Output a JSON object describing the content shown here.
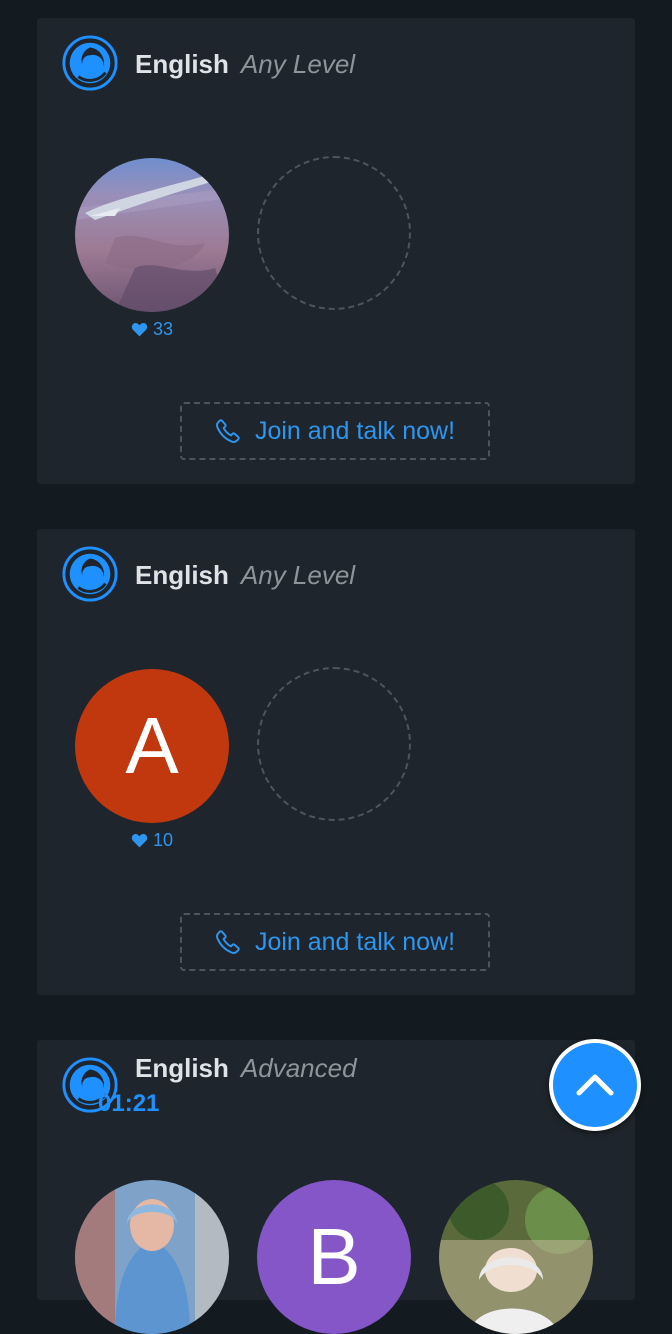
{
  "rooms": [
    {
      "language": "English",
      "level": "Any Level",
      "host": {
        "type": "photo",
        "likes": "33"
      },
      "join_label": "Join and talk now!"
    },
    {
      "language": "English",
      "level": "Any Level",
      "host": {
        "type": "letter",
        "letter": "A",
        "color": "#c1380f",
        "likes": "10"
      },
      "join_label": "Join and talk now!"
    },
    {
      "language": "English",
      "level": "Advanced",
      "timer": "01:21",
      "participants": [
        {
          "type": "photo"
        },
        {
          "type": "letter",
          "letter": "B",
          "color": "#8456c7"
        },
        {
          "type": "photo"
        }
      ]
    }
  ],
  "colors": {
    "accent": "#1e90ff",
    "card": "#1e252c",
    "background": "#141b20"
  },
  "icons": {
    "brand": "swirl-logo-icon",
    "like": "heart-icon",
    "join": "phone-icon",
    "scroll_top": "chevron-up-icon"
  }
}
